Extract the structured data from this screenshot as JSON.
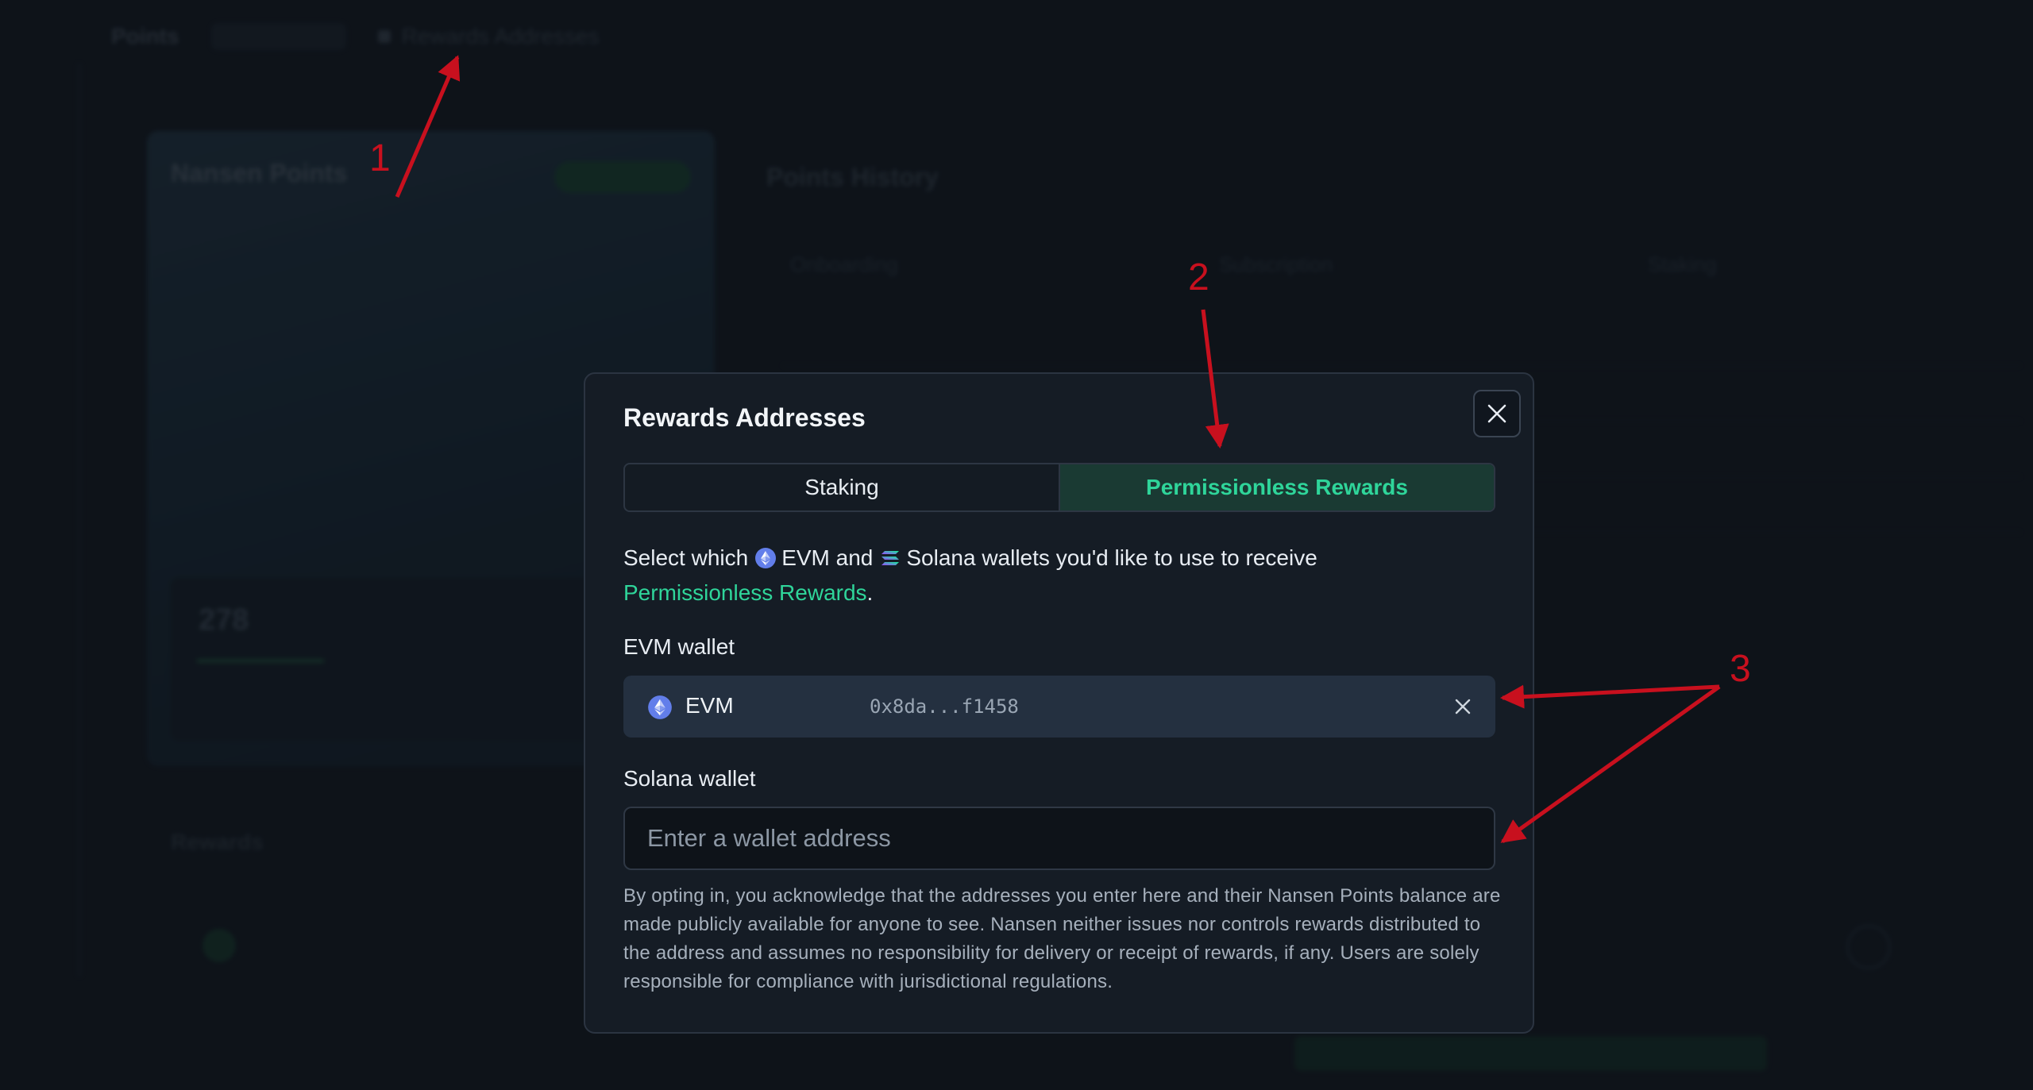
{
  "background": {
    "topbar": {
      "title": "Points",
      "crumb": "Rewards Addresses"
    },
    "card": {
      "title": "Nansen Points",
      "points": "278"
    },
    "panel": {
      "title": "Points History",
      "tabs": [
        "Onboarding",
        "Subscription",
        "Staking"
      ]
    },
    "rewards": {
      "title": "Rewards"
    }
  },
  "modal": {
    "title": "Rewards Addresses",
    "tabs": {
      "staking": "Staking",
      "permissionless": "Permissionless Rewards",
      "active": "permissionless"
    },
    "description": {
      "part1": "Select which",
      "evm": "EVM and",
      "solana": "Solana wallets you'd like to use to receive",
      "link": "Permissionless Rewards",
      "end": "."
    },
    "evm_wallet": {
      "label": "EVM wallet",
      "chain": "EVM",
      "address": "0x8da...f1458"
    },
    "solana_wallet": {
      "label": "Solana wallet",
      "placeholder": "Enter a wallet address"
    },
    "disclaimer": "By opting in, you acknowledge that the addresses you enter here and their Nansen Points balance are made publicly available for anyone to see. Nansen neither issues nor controls rewards distributed to the address and assumes no responsibility for delivery or receipt of rewards, if any. Users are solely responsible for compliance with jurisdictional regulations."
  },
  "annotations": [
    "1",
    "2",
    "3"
  ],
  "colors": {
    "accent_green": "#2fd59a",
    "annotation_red": "#c8101e",
    "ethereum_purple": "#627eea"
  },
  "icons": [
    "close-icon",
    "ethereum-icon",
    "solana-icon",
    "clear-icon"
  ]
}
